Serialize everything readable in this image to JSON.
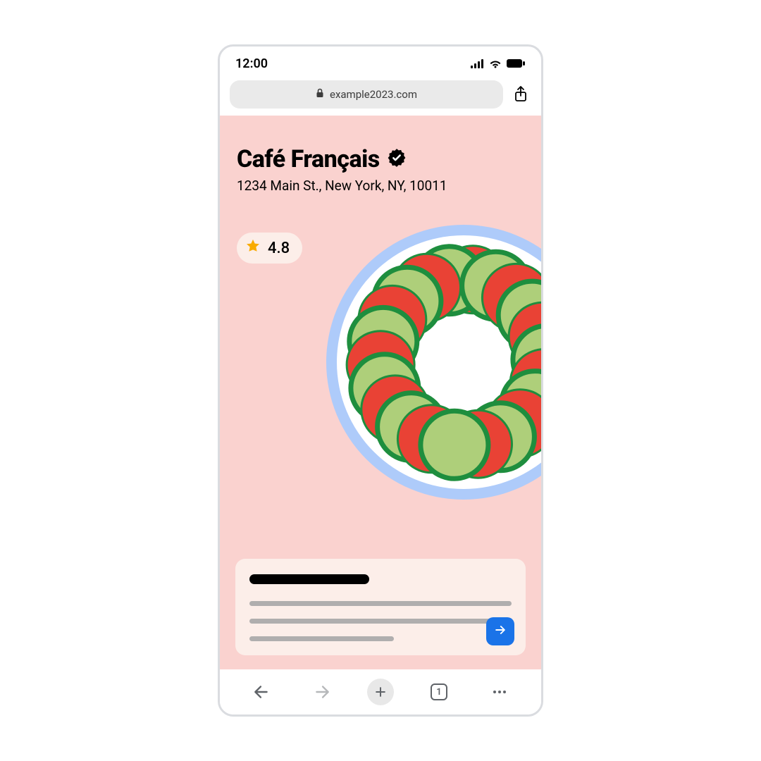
{
  "status": {
    "time": "12:00"
  },
  "browser": {
    "url": "example2023.com",
    "tab_count": "1"
  },
  "page": {
    "title": "Café Français",
    "address": "1234 Main St., New York, NY, 10011",
    "rating": "4.8"
  },
  "icons": {
    "verified": "verified-badge",
    "star": "star",
    "lock": "lock",
    "share": "share",
    "back": "back",
    "forward": "forward",
    "plus": "plus",
    "tabs": "tabs",
    "more": "more",
    "arrow_right": "arrow-right"
  }
}
